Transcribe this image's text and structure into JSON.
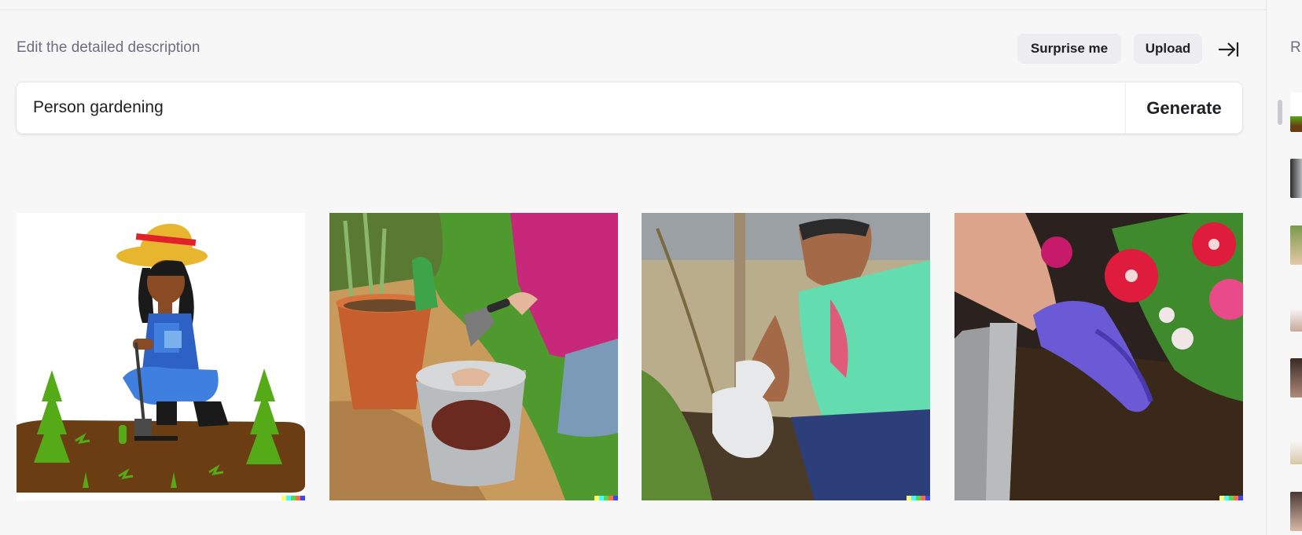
{
  "header": {
    "label": "Edit the detailed description",
    "surprise_label": "Surprise me",
    "upload_label": "Upload"
  },
  "prompt": {
    "value": "Person gardening",
    "generate_label": "Generate"
  },
  "results": [
    {
      "name": "cartoon woman gardening"
    },
    {
      "name": "person with trowel, pot and bucket"
    },
    {
      "name": "man planting a shrub"
    },
    {
      "name": "gloved hand planting petunias"
    }
  ],
  "sidebar": {
    "title": "R"
  },
  "icons": {
    "collapse": "collapse-right-icon"
  },
  "colors": {
    "button_bg": "#ececf1",
    "text": "#202123",
    "muted": "#6e6e80",
    "signature": [
      "#ffff66",
      "#42ffff",
      "#51da4c",
      "#ff6e3c",
      "#3c46ff"
    ]
  }
}
